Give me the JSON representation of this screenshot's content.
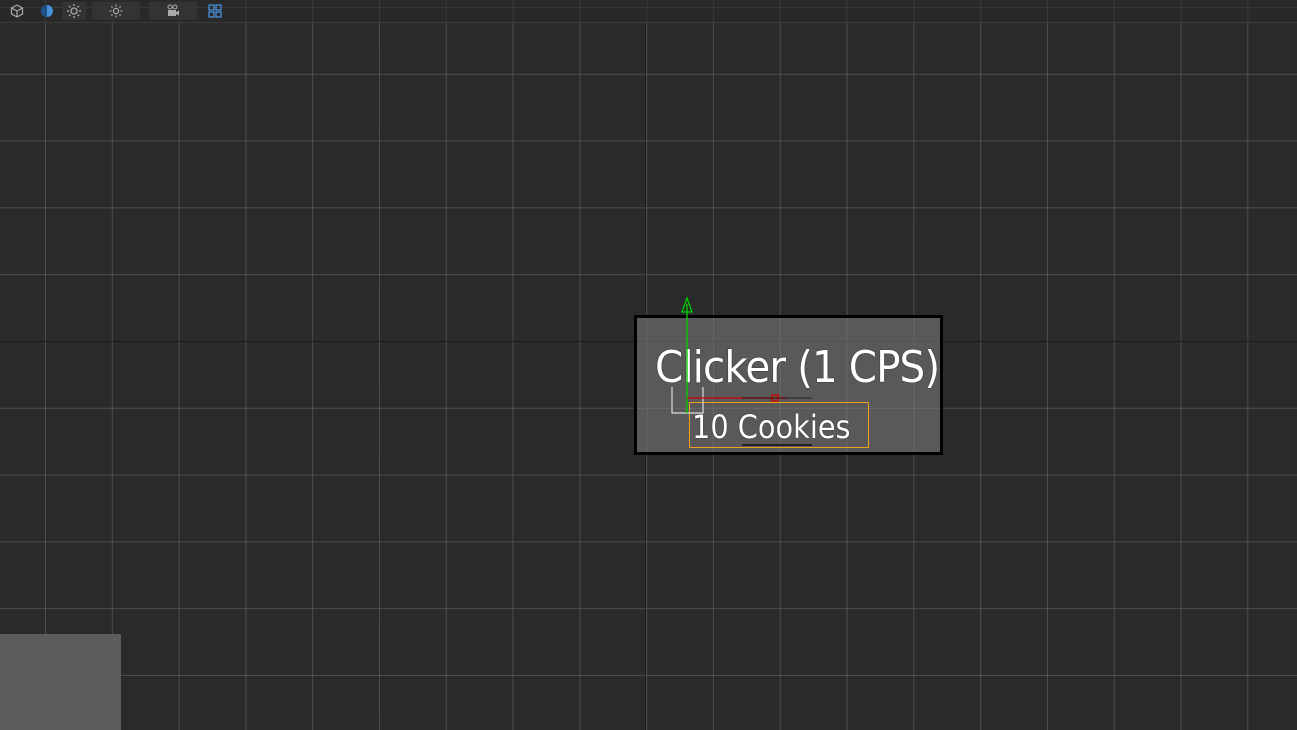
{
  "toolbar": {
    "buttons": [
      {
        "name": "view-cube-icon",
        "tooltip": ""
      },
      {
        "name": "shading-mode-icon",
        "tooltip": ""
      },
      {
        "name": "sun-light-icon",
        "tooltip": ""
      },
      {
        "name": "light-settings-icon",
        "tooltip": ""
      },
      {
        "name": "camera-settings-icon",
        "tooltip": ""
      },
      {
        "name": "grid-layout-icon",
        "tooltip": ""
      }
    ]
  },
  "scene": {
    "title": "Clicker (1 CPS)",
    "count_label": "10 Cookies"
  },
  "colors": {
    "background": "#2a2a2a",
    "grid_line": "#5a5a5a",
    "card_fill": "#808080",
    "card_border": "#000000",
    "selection": "#f0a020",
    "gizmo_y": "#00d000",
    "gizmo_x": "#d00000",
    "accent_blue": "#4a90d9"
  }
}
